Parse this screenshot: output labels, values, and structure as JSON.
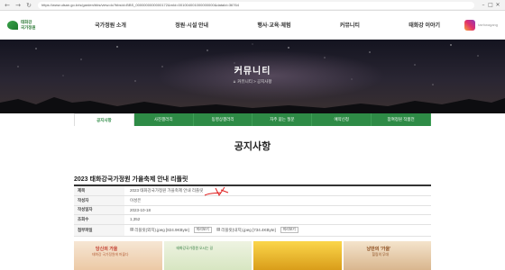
{
  "browser": {
    "url": "https://www.ulsan.go.kr/s/garden/bbs/view.do?bbsId=BBS_0000000000000172&mId=001004001000000000&dataId=36764"
  },
  "header": {
    "logo_line1": "태화강",
    "logo_line2": "국가정원",
    "nav": [
      "국가정원 소개",
      "정원·시설 안내",
      "행사·교육·체험",
      "커뮤니티",
      "태화강 이야기"
    ],
    "sns_label": "taehwagang"
  },
  "hero": {
    "title": "커뮤니티",
    "breadcrumb": "커뮤니티 > 공지사항"
  },
  "sub_tabs": [
    "공지사항",
    "사진갤러리",
    "동영상갤러리",
    "자주 묻는 질문",
    "예약신청",
    "참여정원 작품전"
  ],
  "page_title": "공지사항",
  "post": {
    "title": "2023 태화강국가정원 가을축제 안내 리플릿",
    "fields": [
      {
        "label": "제목",
        "value": "2023 태화강국가정원 가을축제 안내 리플릿"
      },
      {
        "label": "작성자",
        "value": "이성은"
      },
      {
        "label": "작성일자",
        "value": "2023-10-18"
      },
      {
        "label": "조회수",
        "value": "1,352"
      }
    ],
    "attachments_label": "첨부파일",
    "attachments": [
      {
        "name": "리플릿(외지).jpeg [824.9KByte]"
      },
      {
        "name": "리플릿(내지).jpeg [734.4KByte]"
      }
    ],
    "preview_label": "미리보기"
  },
  "leaflets": [
    {
      "title": "당신의 가을",
      "sub": "태화강 국가정원에 머물다"
    },
    {
      "title": "",
      "sub": "태화강국가정원 오시는 길"
    },
    {
      "title": "",
      "sub": ""
    },
    {
      "title": "낭만의 '가을'",
      "sub": "힐링의 무대"
    }
  ],
  "colors": {
    "tab_green": "#2e8b46",
    "hero_dark": "#141420"
  },
  "icons": [
    "back-arrow-icon",
    "forward-arrow-icon",
    "refresh-icon",
    "home-icon",
    "file-icon",
    "instagram-icon"
  ]
}
